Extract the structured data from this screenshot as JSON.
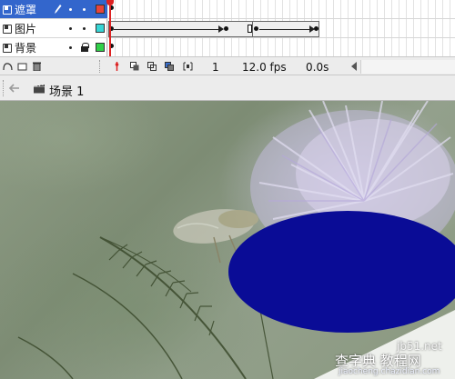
{
  "timeline": {
    "layers": [
      {
        "name": "遮罩",
        "selected": true,
        "color": "#e8443a",
        "icons": [
          "pencil-icon",
          "visibility-dot",
          "lock-dot"
        ]
      },
      {
        "name": "图片",
        "selected": false,
        "color": "#37d6d6",
        "icons": [
          "visibility-dot",
          "lock-dot"
        ]
      },
      {
        "name": "背景",
        "selected": false,
        "color": "#2fd048",
        "icons": [
          "visibility-dot",
          "lock-icon"
        ]
      }
    ],
    "toolbar": {
      "current_frame": "1",
      "frame_rate": "12.0 fps",
      "elapsed_time": "0.0s"
    }
  },
  "edit_bar": {
    "scene_label": "场景 1"
  },
  "stage": {
    "mask_ellipse_color": "#0a0c96",
    "watermark": {
      "brand": "jb51.net",
      "site_text": "查字典 教程网",
      "url_text": "jiaocheng.chazidian.com"
    }
  },
  "colors": {
    "playhead": "#dd2222",
    "selected_layer": "#3366cc"
  }
}
